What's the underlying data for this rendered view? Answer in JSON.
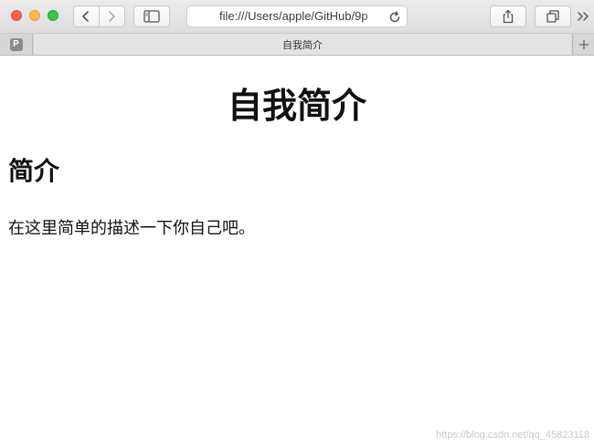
{
  "browser": {
    "address_url": "file:///Users/apple/GitHub/9p",
    "colors": {
      "close": "#fc605c",
      "minimize": "#fdbc40",
      "zoom": "#34c84a"
    },
    "icons": {
      "back": "chevron-left-icon",
      "forward": "chevron-right-icon",
      "sidebar": "sidebar-icon",
      "reload": "reload-icon",
      "share": "share-icon",
      "tabs": "tabs-overview-icon",
      "more": "double-chevron-right-icon",
      "new_tab": "plus-icon"
    }
  },
  "tabs": {
    "pinned_label": "P",
    "active_title": "自我简介"
  },
  "page": {
    "h1": "自我简介",
    "h2": "简介",
    "paragraph": "在这里简单的描述一下你自己吧。"
  },
  "watermark": "https://blog.csdn.net/qq_45823118"
}
